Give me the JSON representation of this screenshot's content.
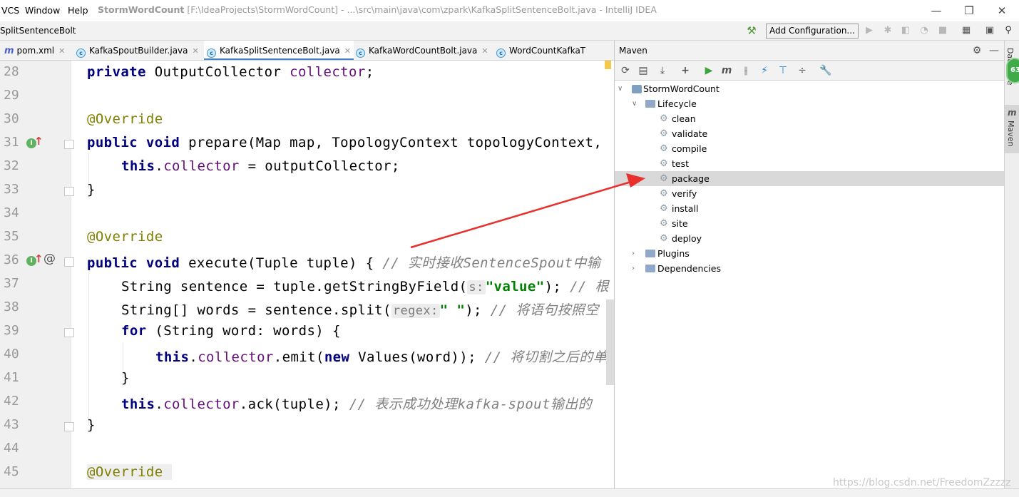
{
  "titlebar": {
    "menu": [
      "VCS",
      "Window",
      "Help"
    ],
    "project": "StormWordCount",
    "path": "[F:\\IdeaProjects\\StormWordCount] - ...\\src\\main\\java\\com\\zpark\\KafkaSplitSentenceBolt.java - IntelliJ IDEA",
    "minimize": "—",
    "restore": "❐",
    "close": "✕"
  },
  "navbar": {
    "breadcrumb": "SplitSentenceBolt",
    "add_configuration": "Add Configuration..."
  },
  "tabs": [
    {
      "label": "pom.xml",
      "icon": "m"
    },
    {
      "label": "KafkaSpoutBuilder.java",
      "icon": "c"
    },
    {
      "label": "KafkaSplitSentenceBolt.java",
      "icon": "c",
      "active": true
    },
    {
      "label": "KafkaWordCountBolt.java",
      "icon": "c"
    },
    {
      "label": "WordCountKafkaT",
      "icon": "c"
    }
  ],
  "editor": {
    "line_numbers": [
      "28",
      "29",
      "30",
      "31",
      "32",
      "33",
      "34",
      "35",
      "36",
      "37",
      "38",
      "39",
      "40",
      "41",
      "42",
      "43",
      "44",
      "45"
    ],
    "lines": {
      "l28_kw": "private",
      "l28_type": " OutputCollector ",
      "l28_fld": "collector",
      "l28_end": ";",
      "l30_ann": "@Override",
      "l31_kw": "public void",
      "l31_rest": " prepare(Map map, TopologyContext topologyContext,",
      "l32_kw": "this",
      "l32_dot": ".",
      "l32_fld": "collector",
      "l32_rest": " = outputCollector;",
      "l33": "}",
      "l35_ann": "@Override",
      "l36_kw": "public void",
      "l36_rest": " execute(Tuple tuple) { ",
      "l36_cmt": "// 实时接收SentenceSpout中输",
      "l37_a": "String sentence = tuple.getStringByField(",
      "l37_hint": "s:",
      "l37_str": "\"value\"",
      "l37_b": "); ",
      "l37_cmt": "// 根",
      "l38_a": "String[] words = sentence.split(",
      "l38_hint": "regex:",
      "l38_str": "\" \"",
      "l38_b": "); ",
      "l38_cmt": "// 将语句按照空",
      "l39_kw": "for",
      "l39_rest": " (String word: words) {",
      "l40_kw": "this",
      "l40_dot": ".",
      "l40_fld": "collector",
      "l40_a": ".emit(",
      "l40_kw2": "new",
      "l40_b": " Values(word)); ",
      "l40_cmt": "// 将切割之后的单",
      "l41": "}",
      "l42_kw": "this",
      "l42_dot": ".",
      "l42_fld": "collector",
      "l42_a": ".ack(tuple); ",
      "l42_cmt": "// 表示成功处理kafka-spout输出的",
      "l43": "}",
      "l45_ann": "@Override"
    }
  },
  "maven": {
    "title": "Maven",
    "tree": {
      "project": "StormWordCount",
      "lifecycle": "Lifecycle",
      "goals": [
        "clean",
        "validate",
        "compile",
        "test",
        "package",
        "verify",
        "install",
        "site",
        "deploy"
      ],
      "selected_goal": "package",
      "plugins": "Plugins",
      "dependencies": "Dependencies"
    }
  },
  "strip": {
    "database": "Database",
    "maven": "Maven",
    "badge": "63"
  },
  "watermark": "https://blog.csdn.net/FreedomZzzzz",
  "colors": {
    "keyword": "#000080",
    "field": "#660e7a",
    "annotation": "#808000",
    "string": "#008000",
    "comment": "#808080",
    "annotation_arrow": "#e8302d"
  }
}
